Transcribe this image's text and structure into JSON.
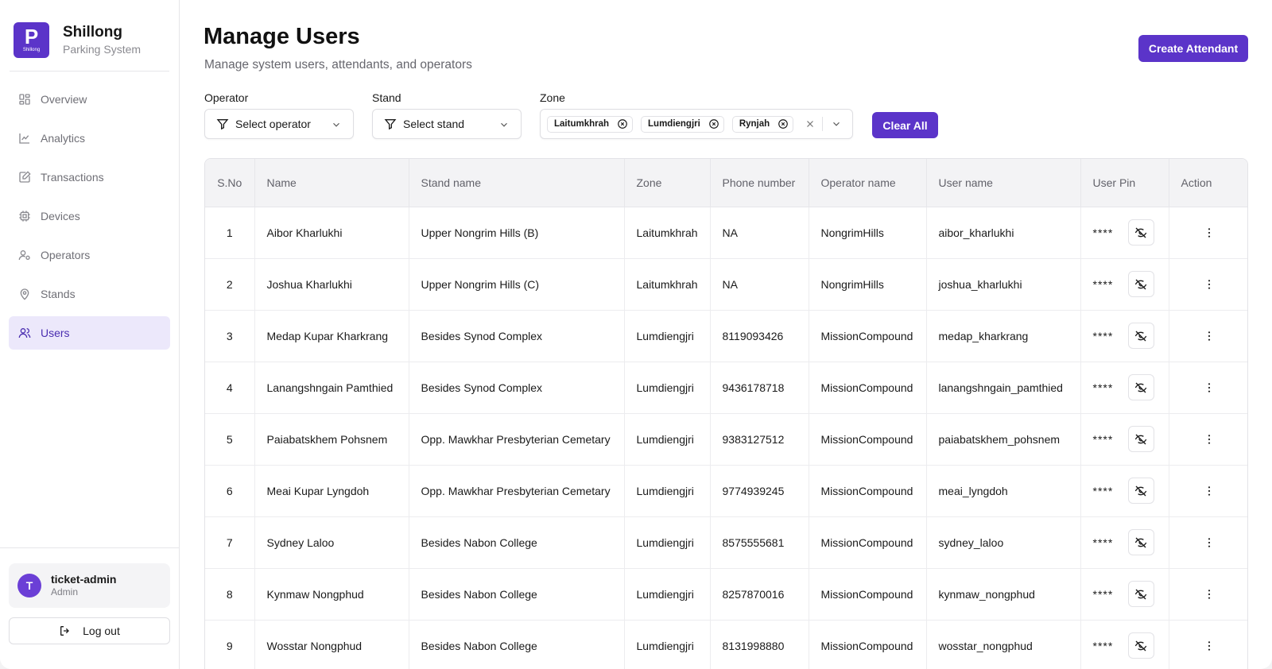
{
  "brand": {
    "logo_letter": "P",
    "logo_sub": "Shillong",
    "title": "Shillong",
    "subtitle": "Parking System"
  },
  "sidebar": {
    "items": [
      {
        "label": "Overview",
        "icon": "grid-icon"
      },
      {
        "label": "Analytics",
        "icon": "line-chart-icon"
      },
      {
        "label": "Transactions",
        "icon": "edit-document-icon"
      },
      {
        "label": "Devices",
        "icon": "chip-icon"
      },
      {
        "label": "Operators",
        "icon": "user-key-icon"
      },
      {
        "label": "Stands",
        "icon": "map-pin-icon"
      },
      {
        "label": "Users",
        "icon": "users-icon",
        "active": true
      }
    ],
    "user": {
      "initial": "T",
      "name": "ticket-admin",
      "role": "Admin"
    },
    "logout_label": "Log out"
  },
  "header": {
    "title": "Manage Users",
    "subtitle": "Manage system users, attendants, and operators",
    "create_label": "Create Attendant"
  },
  "filters": {
    "operator": {
      "label": "Operator",
      "placeholder": "Select operator"
    },
    "stand": {
      "label": "Stand",
      "placeholder": "Select stand"
    },
    "zone": {
      "label": "Zone",
      "chips": [
        "Laitumkhrah",
        "Lumdiengjri",
        "Rynjah"
      ]
    },
    "clear_label": "Clear All"
  },
  "table": {
    "columns": [
      "S.No",
      "Name",
      "Stand name",
      "Zone",
      "Phone number",
      "Operator name",
      "User name",
      "User Pin",
      "Action"
    ],
    "pin_mask": "****",
    "rows": [
      [
        "1",
        "Aibor Kharlukhi",
        "Upper Nongrim Hills (B)",
        "Laitumkhrah",
        "NA",
        "NongrimHills",
        "aibor_kharlukhi"
      ],
      [
        "2",
        "Joshua Kharlukhi",
        "Upper Nongrim Hills (C)",
        "Laitumkhrah",
        "NA",
        "NongrimHills",
        "joshua_kharlukhi"
      ],
      [
        "3",
        "Medap Kupar Kharkrang",
        "Besides Synod Complex",
        "Lumdiengjri",
        "8119093426",
        "MissionCompound",
        "medap_kharkrang"
      ],
      [
        "4",
        "Lanangshngain Pamthied",
        "Besides Synod Complex",
        "Lumdiengjri",
        "9436178718",
        "MissionCompound",
        "lanangshngain_pamthied"
      ],
      [
        "5",
        "Paiabatskhem Pohsnem",
        "Opp. Mawkhar Presbyterian Cemetary",
        "Lumdiengjri",
        "9383127512",
        "MissionCompound",
        "paiabatskhem_pohsnem"
      ],
      [
        "6",
        "Meai Kupar Lyngdoh",
        "Opp. Mawkhar Presbyterian Cemetary",
        "Lumdiengjri",
        "9774939245",
        "MissionCompound",
        "meai_lyngdoh"
      ],
      [
        "7",
        "Sydney Laloo",
        "Besides Nabon College",
        "Lumdiengjri",
        "8575555681",
        "MissionCompound",
        "sydney_laloo"
      ],
      [
        "8",
        "Kynmaw Nongphud",
        "Besides Nabon College",
        "Lumdiengjri",
        "8257870016",
        "MissionCompound",
        "kynmaw_nongphud"
      ],
      [
        "9",
        "Wosstar Nongphud",
        "Besides Nabon College",
        "Lumdiengjri",
        "8131998880",
        "MissionCompound",
        "wosstar_nongphud"
      ]
    ]
  },
  "colors": {
    "accent": "#5b34c9",
    "active_bg": "#ece8fb"
  }
}
